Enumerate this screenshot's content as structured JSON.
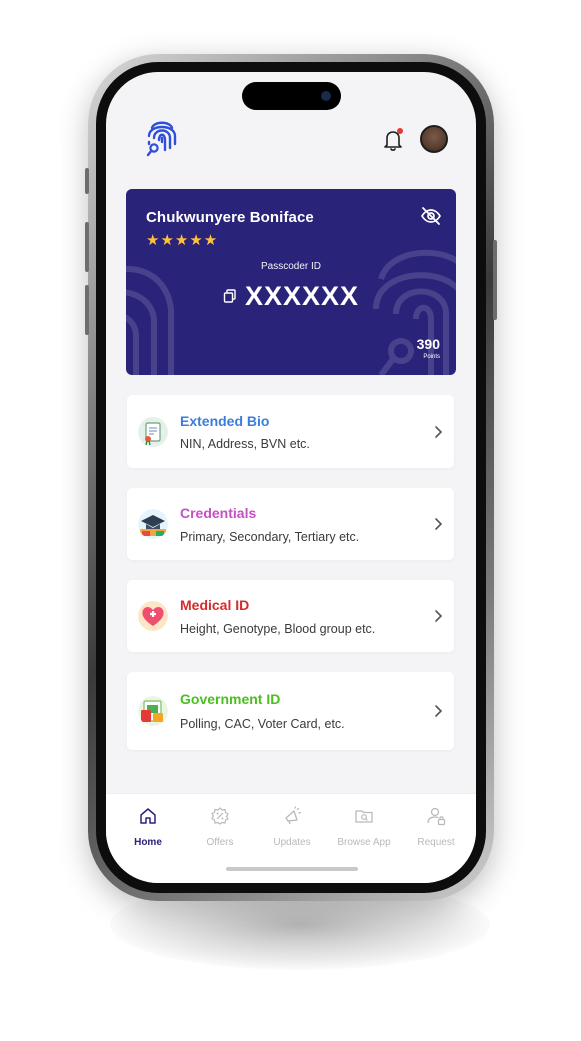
{
  "colors": {
    "card_bg": "#2a237a",
    "star": "#ffc13b",
    "extended_bio": "#3b7ddd",
    "credentials": "#c64fc2",
    "medical": "#d62b2b",
    "government": "#4bbf1f",
    "nav_active": "#2a237a",
    "nav_inactive": "#b9b9bd"
  },
  "header": {
    "logo_icon": "fingerprint-logo-icon",
    "notification_icon": "bell-icon",
    "avatar_icon": "user-avatar"
  },
  "card": {
    "name": "Chukwunyere Boniface",
    "stars": "★★★★★",
    "rating": 5,
    "passcode_label": "Passcoder ID",
    "passcode_value": "XXXXXX",
    "points": "390",
    "points_label": "Points",
    "hide_icon": "eye-off-icon",
    "copy_icon": "copy-icon"
  },
  "menu": [
    {
      "title": "Extended Bio",
      "subtitle": "NIN, Address, BVN etc.",
      "icon": "certificate-icon"
    },
    {
      "title": "Credentials",
      "subtitle": "Primary, Secondary, Tertiary etc.",
      "icon": "graduation-cap-icon"
    },
    {
      "title": "Medical ID",
      "subtitle": "Height, Genotype, Blood group etc.",
      "icon": "heart-medical-icon"
    },
    {
      "title": "Government ID",
      "subtitle": "Polling, CAC, Voter Card, etc.",
      "icon": "government-document-icon"
    }
  ],
  "nav": [
    {
      "label": "Home",
      "icon": "home-icon",
      "active": true
    },
    {
      "label": "Offers",
      "icon": "discount-icon",
      "active": false
    },
    {
      "label": "Updates",
      "icon": "megaphone-icon",
      "active": false
    },
    {
      "label": "Browse App",
      "icon": "folder-search-icon",
      "active": false
    },
    {
      "label": "Request",
      "icon": "user-lock-icon",
      "active": false
    }
  ]
}
